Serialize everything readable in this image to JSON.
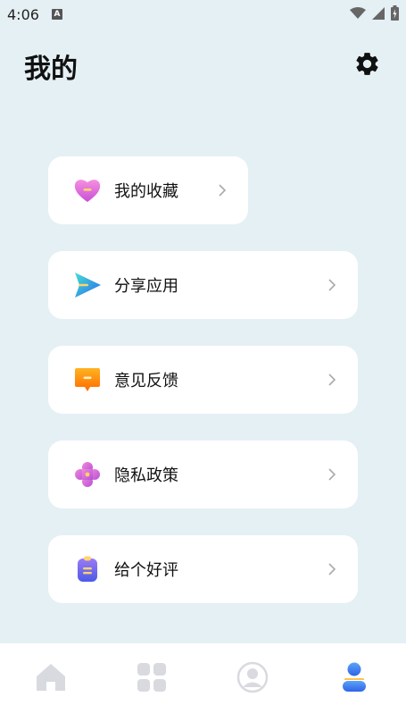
{
  "status_bar": {
    "time": "4:06",
    "notification_badge": "A",
    "icons": [
      "wifi-icon",
      "signal-icon",
      "battery-icon"
    ]
  },
  "header": {
    "title": "我的",
    "settings_icon": "gear-icon"
  },
  "menu": {
    "items": [
      {
        "label": "我的收藏",
        "icon": "heart-icon",
        "color": "#e86bd0"
      },
      {
        "label": "分享应用",
        "icon": "send-icon",
        "color": "#2f8cf0"
      },
      {
        "label": "意见反馈",
        "icon": "feedback-icon",
        "color": "#ff8a00"
      },
      {
        "label": "隐私政策",
        "icon": "flower-icon",
        "color": "#d46be0"
      },
      {
        "label": "给个好评",
        "icon": "clipboard-icon",
        "color": "#6b6cf0"
      }
    ]
  },
  "bottom_nav": {
    "items": [
      {
        "icon": "home-icon",
        "active": false
      },
      {
        "icon": "grid-icon",
        "active": false
      },
      {
        "icon": "profile-circle-icon",
        "active": false
      },
      {
        "icon": "user-icon",
        "active": true
      }
    ],
    "active_color": "#3a7bf0",
    "inactive_color": "#d6d8de"
  },
  "colors": {
    "background": "#e5f0f5",
    "card": "#ffffff"
  }
}
